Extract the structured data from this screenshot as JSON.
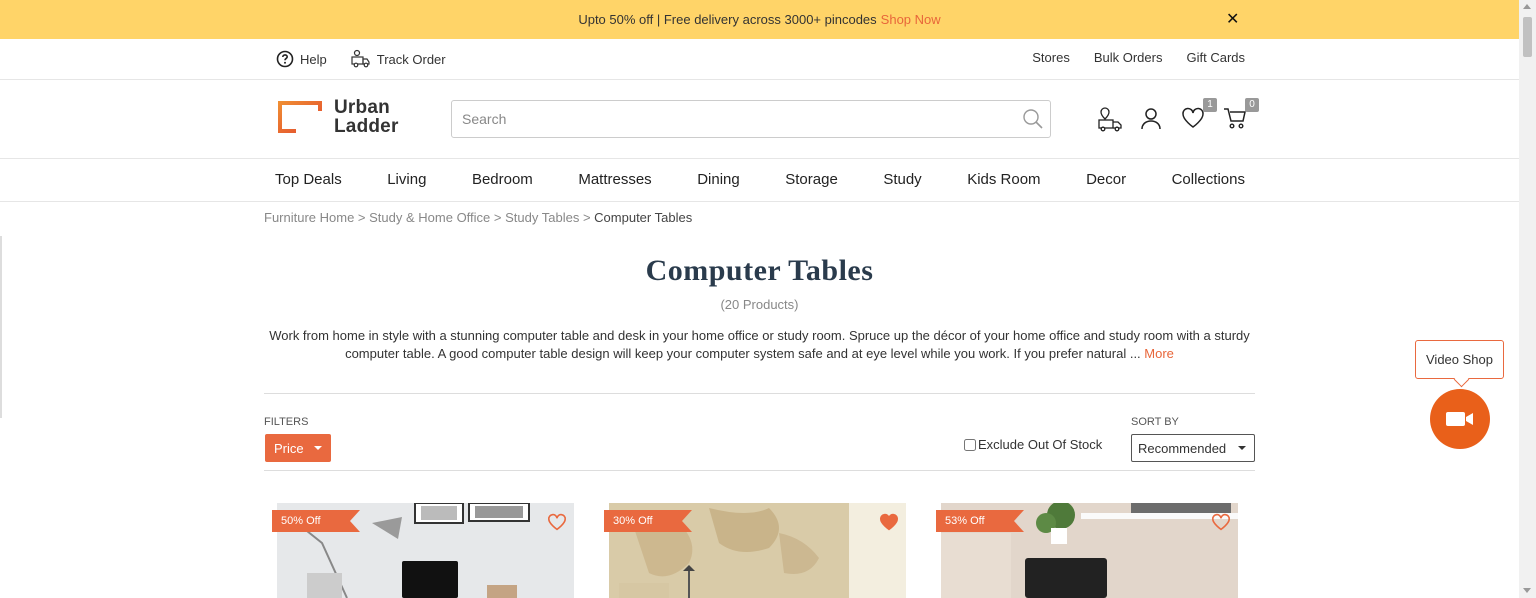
{
  "banner": {
    "text": "Upto 50% off | Free delivery across 3000+ pincodes",
    "link": "Shop Now",
    "close": "✕"
  },
  "util": {
    "help": "Help",
    "track": "Track Order",
    "right": [
      "Stores",
      "Bulk Orders",
      "Gift Cards"
    ]
  },
  "logo": {
    "line1": "Urban",
    "line2": "Ladder"
  },
  "search": {
    "placeholder": "Search"
  },
  "header_icons": {
    "wishlist_count": "1",
    "cart_count": "0"
  },
  "nav": [
    "Top Deals",
    "Living",
    "Bedroom",
    "Mattresses",
    "Dining",
    "Storage",
    "Study",
    "Kids Room",
    "Decor",
    "Collections"
  ],
  "breadcrumb": {
    "items": [
      "Furniture Home",
      "Study & Home Office",
      "Study Tables"
    ],
    "current": "Computer Tables",
    "sep": " > "
  },
  "page": {
    "title": "Computer Tables",
    "count": "(20 Products)",
    "description": "Work from home in style with a stunning computer table and desk in your home office or study room. Spruce up the décor of your home office and study room with a sturdy computer table. A good computer table design will keep your computer system safe and at eye level while you work. If you prefer natural ...",
    "more": "More"
  },
  "filters": {
    "label": "FILTERS",
    "price": "Price",
    "exclude": "Exclude Out Of Stock",
    "sort_label": "SORT BY",
    "sort_value": "Recommended"
  },
  "products": [
    {
      "discount": "50% Off",
      "wishlisted": false
    },
    {
      "discount": "30% Off",
      "wishlisted": true
    },
    {
      "discount": "53% Off",
      "wishlisted": false
    }
  ],
  "video": {
    "label": "Video Shop"
  },
  "colors": {
    "accent": "#e9693f",
    "banner": "#ffd468"
  }
}
